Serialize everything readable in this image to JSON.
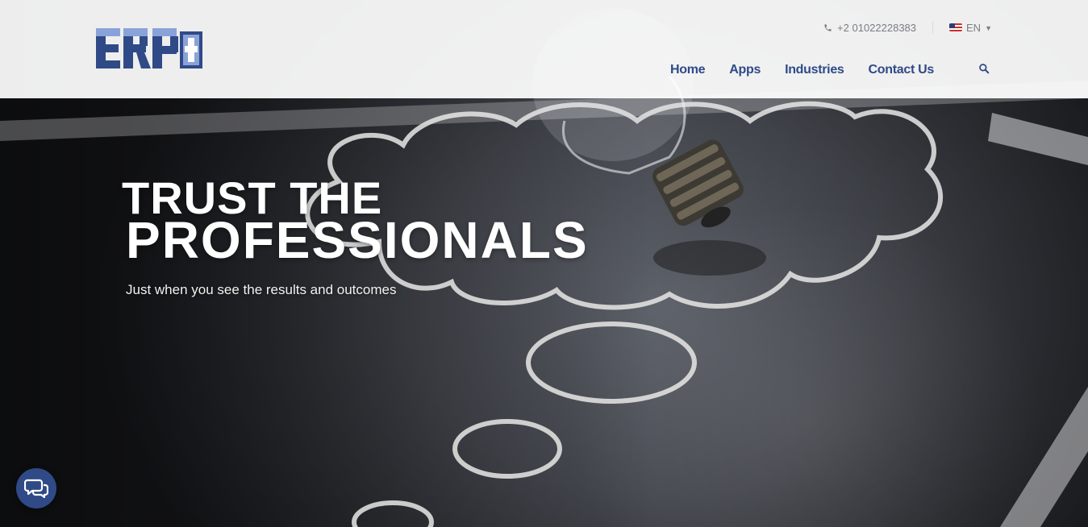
{
  "brand": {
    "logo_text": "ERP"
  },
  "topbar": {
    "phone_icon": "phone-icon",
    "phone": "+2 01022228383",
    "language_flag": "us-flag-icon",
    "language": "EN",
    "language_chevron": "chevron-down-icon"
  },
  "nav": {
    "items": [
      {
        "label": "Home"
      },
      {
        "label": "Apps"
      },
      {
        "label": "Industries"
      },
      {
        "label": "Contact Us"
      }
    ],
    "search_icon": "search-icon"
  },
  "hero": {
    "title_line1": "TRUST THE",
    "title_line2": "PROFESSIONALS",
    "subtitle": "Just when you see the results and outcomes"
  },
  "chat": {
    "icon": "chat-bubbles-icon"
  },
  "colors": {
    "brand_blue": "#2f4a87",
    "logo_light_blue": "#8aa2da",
    "header_bg": "#ffffff",
    "hero_text": "#ffffff",
    "topbar_text": "#7a7d84"
  }
}
